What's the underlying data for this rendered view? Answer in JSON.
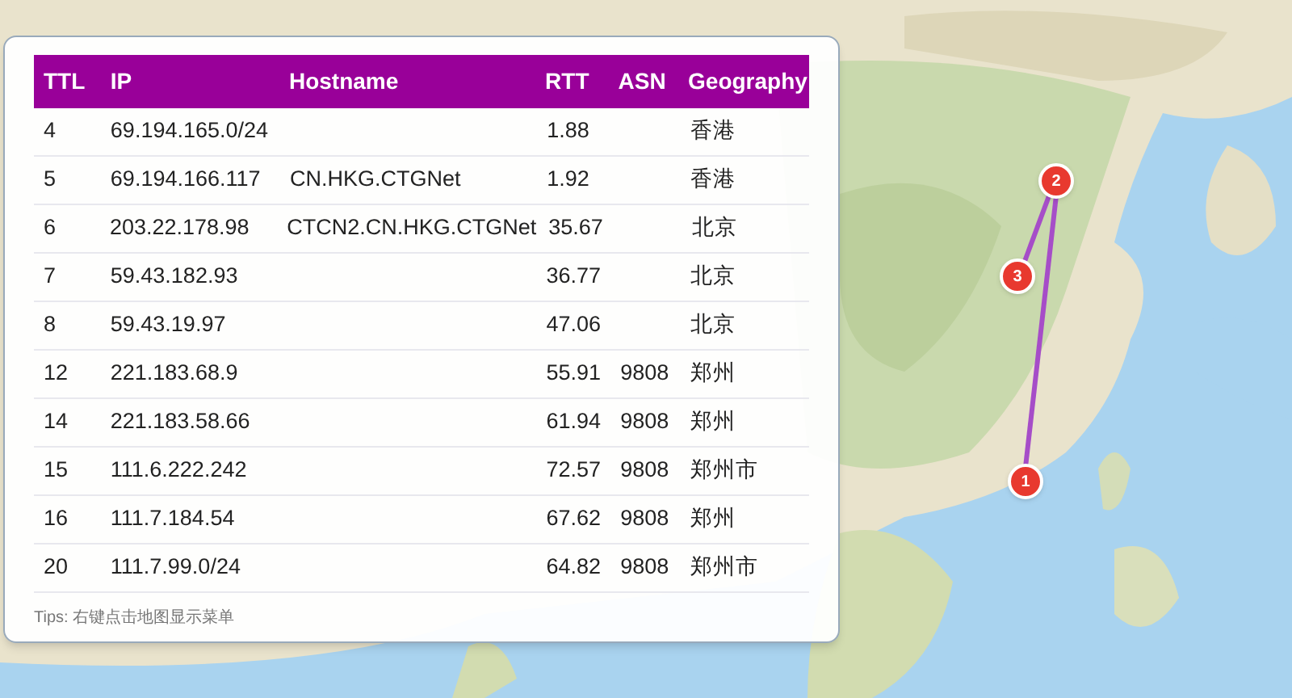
{
  "table": {
    "columns": [
      "TTL",
      "IP",
      "Hostname",
      "RTT",
      "ASN",
      "Geography"
    ],
    "rows": [
      [
        "4",
        "69.194.165.0/24",
        "",
        "1.88",
        "",
        "香港"
      ],
      [
        "5",
        "69.194.166.117",
        "CN.HKG.CTGNet",
        "1.92",
        "",
        "香港"
      ],
      [
        "6",
        "203.22.178.98",
        "CTCN2.CN.HKG.CTGNet",
        "35.67",
        "",
        "北京"
      ],
      [
        "7",
        "59.43.182.93",
        "",
        "36.77",
        "",
        "北京"
      ],
      [
        "8",
        "59.43.19.97",
        "",
        "47.06",
        "",
        "北京"
      ],
      [
        "12",
        "221.183.68.9",
        "",
        "55.91",
        "9808",
        "郑州"
      ],
      [
        "14",
        "221.183.58.66",
        "",
        "61.94",
        "9808",
        "郑州"
      ],
      [
        "15",
        "111.6.222.242",
        "",
        "72.57",
        "9808",
        "郑州市"
      ],
      [
        "16",
        "111.7.184.54",
        "",
        "67.62",
        "9808",
        "郑州"
      ],
      [
        "20",
        "111.7.99.0/24",
        "",
        "64.82",
        "9808",
        "郑州市"
      ]
    ]
  },
  "tips": "Tips: 右键点击地图显示菜单",
  "map_markers": [
    "1",
    "2",
    "3"
  ]
}
